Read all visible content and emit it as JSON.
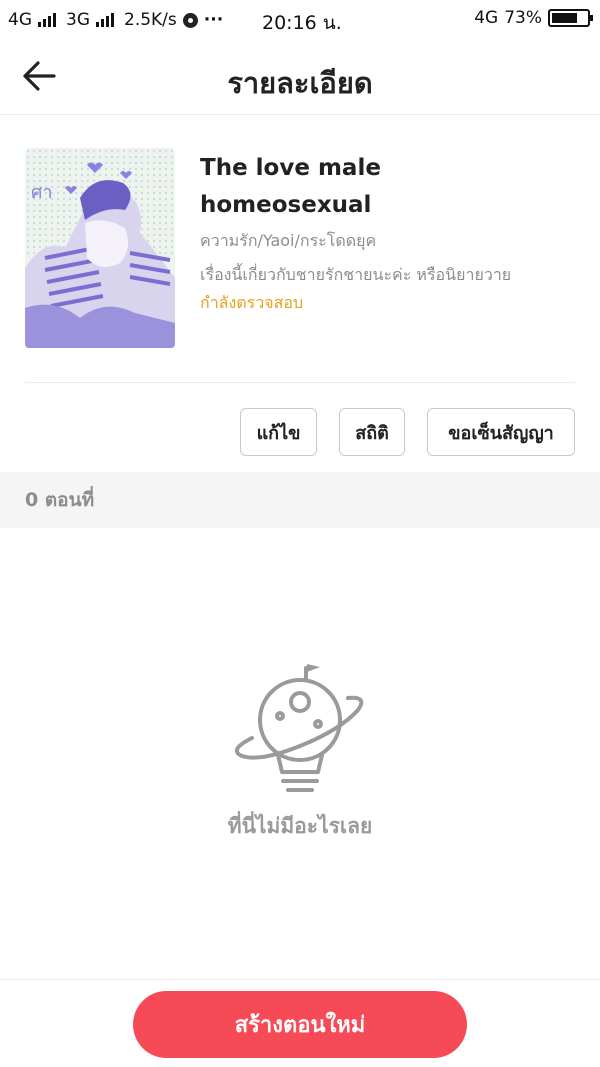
{
  "status_bar": {
    "signal_1": "4G",
    "signal_2": "3G",
    "speed": "2.5K/s",
    "more": "···",
    "time": "20:16 น.",
    "network": "4G",
    "battery": "73%",
    "battery_level": 0.73
  },
  "header": {
    "title": "รายละเอียด"
  },
  "novel": {
    "title": "The love male homeosexual",
    "genre": "ความรัก/Yaoi/กระโดดยุค",
    "description": "เรื่องนี้เกี่ยวกับชายรักชายนะค่ะ หรือนิยายวาย",
    "status": "กำลังตรวจสอบ",
    "status_color": "#e6a11f",
    "cover_icon": "manga-cover-illustration"
  },
  "actions": {
    "edit": "แก้ไข",
    "stats": "สถิติ",
    "contract": "ขอเซ็นสัญญา"
  },
  "episodes": {
    "count_label": "0 ตอนที่"
  },
  "empty_state": {
    "icon": "planet-lightbulb-icon",
    "text": "ที่นี่ไม่มีอะไรเลย"
  },
  "footer": {
    "create_label": "สร้างตอนใหม่",
    "accent": "#f64a57"
  }
}
